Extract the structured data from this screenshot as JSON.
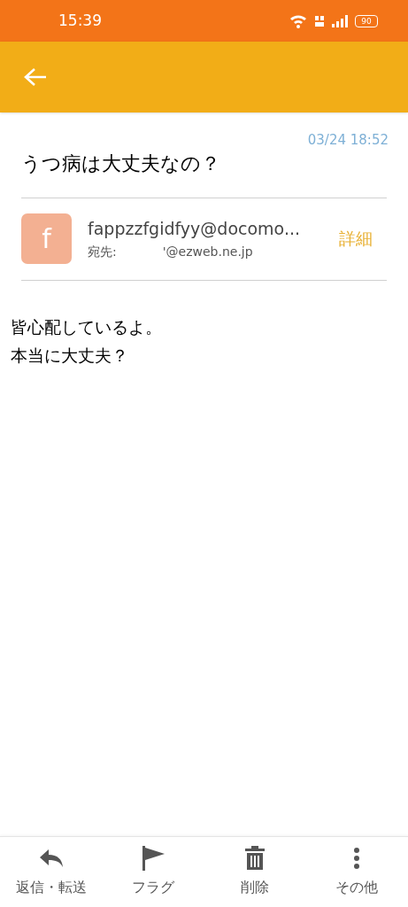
{
  "status_bar": {
    "time": "15:39",
    "battery": "90"
  },
  "message": {
    "date": "03/24 18:52",
    "subject": "うつ病は大丈夫なの？",
    "sender": {
      "initial": "f",
      "address": "fappzzfgidfyy@docomo...",
      "to_label": "宛先:",
      "to_address": "'@ezweb.ne.jp",
      "details": "詳細"
    },
    "body": [
      "皆心配しているよ。",
      "本当に大丈夫？"
    ]
  },
  "toolbar": [
    {
      "kind": "reply",
      "label": "返信・転送"
    },
    {
      "kind": "flag",
      "label": "フラグ"
    },
    {
      "kind": "delete",
      "label": "削除"
    },
    {
      "kind": "more",
      "label": "その他"
    }
  ]
}
